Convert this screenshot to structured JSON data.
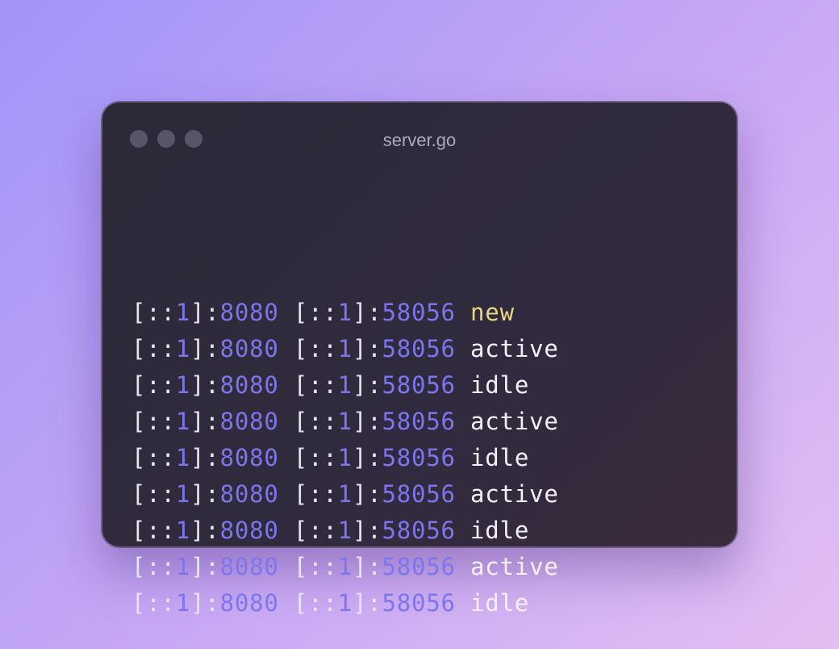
{
  "window": {
    "title": "server.go"
  },
  "colors": {
    "punctuation": "#e7e5ee",
    "number": "#7c76ee",
    "status": "#f3f1f7",
    "status_new": "#e8d67e"
  },
  "lines": [
    {
      "local_host": "1",
      "local_port": "8080",
      "remote_host": "1",
      "remote_port": "58056",
      "status": "new"
    },
    {
      "local_host": "1",
      "local_port": "8080",
      "remote_host": "1",
      "remote_port": "58056",
      "status": "active"
    },
    {
      "local_host": "1",
      "local_port": "8080",
      "remote_host": "1",
      "remote_port": "58056",
      "status": "idle"
    },
    {
      "local_host": "1",
      "local_port": "8080",
      "remote_host": "1",
      "remote_port": "58056",
      "status": "active"
    },
    {
      "local_host": "1",
      "local_port": "8080",
      "remote_host": "1",
      "remote_port": "58056",
      "status": "idle"
    },
    {
      "local_host": "1",
      "local_port": "8080",
      "remote_host": "1",
      "remote_port": "58056",
      "status": "active"
    },
    {
      "local_host": "1",
      "local_port": "8080",
      "remote_host": "1",
      "remote_port": "58056",
      "status": "idle"
    },
    {
      "local_host": "1",
      "local_port": "8080",
      "remote_host": "1",
      "remote_port": "58056",
      "status": "active"
    },
    {
      "local_host": "1",
      "local_port": "8080",
      "remote_host": "1",
      "remote_port": "58056",
      "status": "idle"
    }
  ]
}
